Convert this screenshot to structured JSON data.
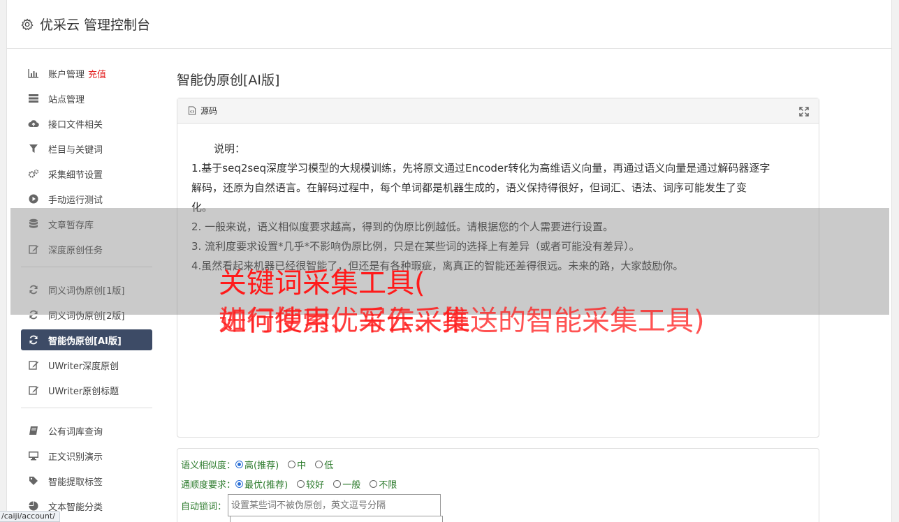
{
  "app": {
    "title": "优采云 管理控制台"
  },
  "sidebar": {
    "items": [
      {
        "label": "账户管理",
        "extra": "充值",
        "icon": "bar-chart-icon"
      },
      {
        "label": "站点管理",
        "icon": "server-icon"
      },
      {
        "label": "接口文件相关",
        "icon": "cloud-upload-icon"
      },
      {
        "label": "栏目与关键词",
        "icon": "filter-icon"
      },
      {
        "label": "采集细节设置",
        "icon": "cogs-icon"
      },
      {
        "label": "手动运行测试",
        "icon": "play-circle-icon"
      },
      {
        "label": "文章暂存库",
        "icon": "database-icon"
      },
      {
        "label": "深度原创任务",
        "icon": "edit-icon"
      },
      {
        "label": "同义词伪原创[1版]",
        "icon": "refresh-icon"
      },
      {
        "label": "同义词伪原创[2版]",
        "icon": "refresh-icon"
      },
      {
        "label": "智能伪原创[AI版]",
        "icon": "refresh-icon",
        "active": true
      },
      {
        "label": "UWriter深度原创",
        "icon": "edit-icon"
      },
      {
        "label": "UWriter原创标题",
        "icon": "edit-icon"
      },
      {
        "label": "公有词库查询",
        "icon": "book-icon"
      },
      {
        "label": "正文识别演示",
        "icon": "desktop-icon"
      },
      {
        "label": "智能提取标签",
        "icon": "tag-icon"
      },
      {
        "label": "文本智能分类",
        "icon": "pie-chart-icon"
      }
    ]
  },
  "main": {
    "title": "智能伪原创[AI版]",
    "panel": {
      "head_label": "源码",
      "lines": [
        "说明：",
        "1.基于seq2seq深度学习模型的大规模训练，先将原文通过Encoder转化为高维语义向量，再通过语义向量是通过解码器逐字",
        "解码，还原为自然语言。在解码过程中，每个单词都是机器生成的，语义保持得很好，但词汇、语法、词序可能发生了变",
        "化。",
        "2. 一般来说，语义相似度要求越高，得到的伪原比例越低。请根据您的个人需要进行设置。",
        "3. 流利度要求设置*几乎*不影响伪原比例，只是在某些词的选择上有差异（或者可能没有差异）。",
        "4.虽然看起来机器已经很智能了，但还是有各种瑕疵，离真正的智能还差得很远。未来的路，大家鼓励你。"
      ]
    },
    "options": {
      "similarity": {
        "label": "语义相似度：",
        "choices": [
          "高(推荐)",
          "中",
          "低"
        ],
        "selected": 0
      },
      "fluency": {
        "label": "通顺度要求：",
        "choices": [
          "最优(推荐)",
          "较好",
          "一般",
          "不限"
        ],
        "selected": 0
      },
      "lock_words": {
        "label": "自动锁词：",
        "placeholder": "设置某些词不被伪原创，英文逗号分隔"
      }
    }
  },
  "overlay": {
    "line1": "关键词采集工具(",
    "line2a": "如何使用优采云采集",
    "line2b": "进行搜索、写作、推送的智能采集工具)"
  },
  "status_bar": {
    "url": "/caiji/account/"
  }
}
